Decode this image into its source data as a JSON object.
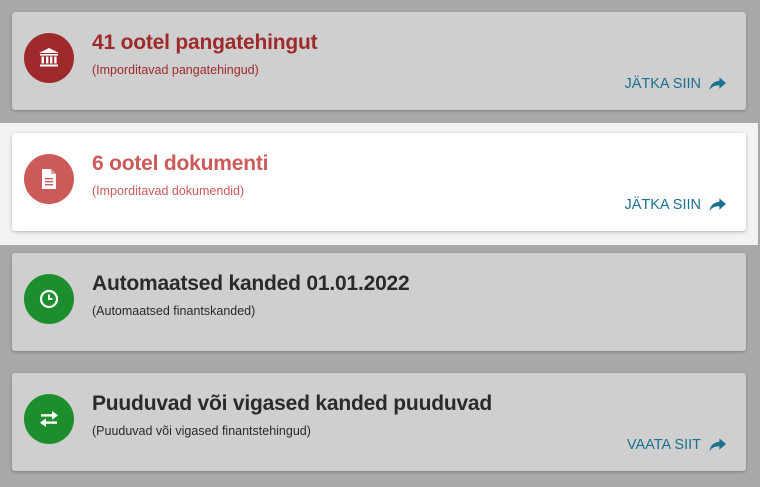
{
  "colors": {
    "bank_red": "#9e2a2b",
    "doc_red": "#cc5a58",
    "green": "#1c8f2c",
    "dark_text": "#2a2a2a",
    "link_blue": "#1b6f8f"
  },
  "cards": [
    {
      "title": "41 ootel pangatehingut",
      "subtitle": "(Imporditavad pangatehingud)",
      "action": "JÄTKA SIIN",
      "icon": "bank-icon"
    },
    {
      "title": "6 ootel dokumenti",
      "subtitle": "(Imporditavad dokumendid)",
      "action": "JÄTKA SIIN",
      "icon": "document-icon"
    },
    {
      "title": "Automaatsed kanded 01.01.2022",
      "subtitle": "(Automaatsed finantskanded)",
      "icon": "clock-icon"
    },
    {
      "title": "Puuduvad või vigased kanded puuduvad",
      "subtitle": "(Puuduvad või vigased finantstehingud)",
      "action": "VAATA SIIT",
      "icon": "transfer-icon"
    }
  ]
}
